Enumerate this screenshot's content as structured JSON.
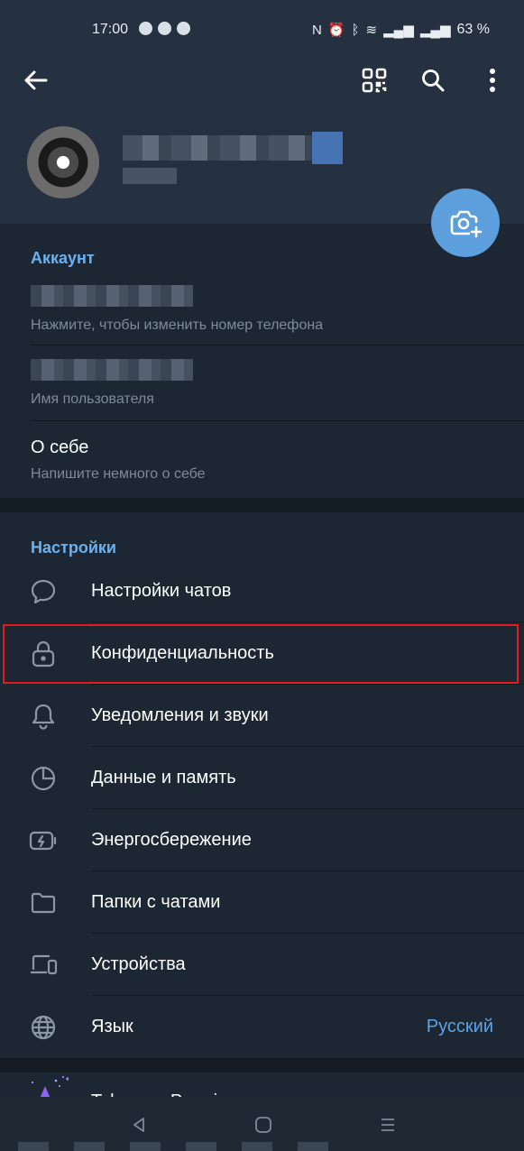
{
  "status_bar": {
    "time": "17:00",
    "battery": "63 %"
  },
  "account": {
    "section_title": "Аккаунт",
    "phone_hint": "Нажмите, чтобы изменить номер телефона",
    "username_hint": "Имя пользователя",
    "bio_label": "О себе",
    "bio_hint": "Напишите немного о себе"
  },
  "settings": {
    "section_title": "Настройки",
    "items": [
      {
        "label": "Настройки чатов",
        "icon": "chat-bubble-icon"
      },
      {
        "label": "Конфиденциальность",
        "icon": "lock-icon"
      },
      {
        "label": "Уведомления и звуки",
        "icon": "bell-icon"
      },
      {
        "label": "Данные и память",
        "icon": "pie-chart-icon"
      },
      {
        "label": "Энергосбережение",
        "icon": "battery-bolt-icon"
      },
      {
        "label": "Папки с чатами",
        "icon": "folder-icon"
      },
      {
        "label": "Устройства",
        "icon": "devices-icon"
      },
      {
        "label": "Язык",
        "icon": "globe-icon",
        "value": "Русский"
      }
    ]
  },
  "premium": {
    "label": "Telegram Premium"
  },
  "colors": {
    "header_bg": "#253040",
    "list_bg": "#1d2733",
    "accent": "#6cb1ef",
    "fab": "#5d9fdc",
    "highlight_border": "#e21a1a"
  }
}
